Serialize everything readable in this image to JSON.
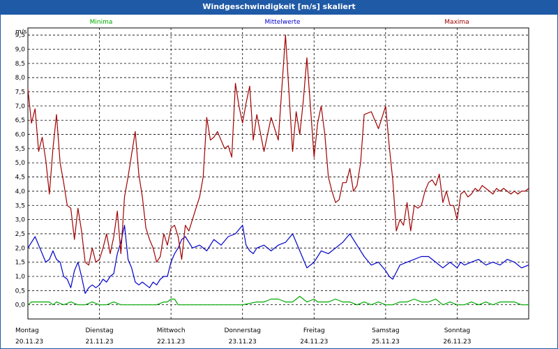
{
  "title": "Windgeschwindigkeit [m/s] skaliert",
  "chart_data": {
    "type": "line",
    "ylabel": "m/s",
    "ylim": [
      -0.5,
      9.75
    ],
    "yticks": [
      0.0,
      0.5,
      1.0,
      1.5,
      2.0,
      2.5,
      3.0,
      3.5,
      4.0,
      4.5,
      5.0,
      5.5,
      6.0,
      6.5,
      7.0,
      7.5,
      8.0,
      8.5,
      9.0,
      9.5
    ],
    "ytick_labels": [
      "0,0",
      "0,5",
      "1,0",
      "1,5",
      "2,0",
      "2,5",
      "3,0",
      "3,5",
      "4,0",
      "4,5",
      "5,0",
      "5,5",
      "6,0",
      "6,5",
      "7,0",
      "7,5",
      "8,0",
      "8,5",
      "9,0",
      "9,5"
    ],
    "xlim": [
      0,
      7
    ],
    "days": [
      {
        "name": "Montag",
        "date": "20.11.23"
      },
      {
        "name": "Dienstag",
        "date": "21.11.23"
      },
      {
        "name": "Mittwoch",
        "date": "22.11.23"
      },
      {
        "name": "Donnerstag",
        "date": "23.11.23"
      },
      {
        "name": "Freitag",
        "date": "24.11.23"
      },
      {
        "name": "Samstag",
        "date": "25.11.23"
      },
      {
        "name": "Sonntag",
        "date": "26.11.23"
      }
    ],
    "series": [
      {
        "name": "Minima",
        "color": "#00aa00",
        "x": [
          0,
          0.05,
          0.1,
          0.2,
          0.3,
          0.35,
          0.4,
          0.5,
          0.6,
          0.7,
          0.8,
          0.9,
          1.0,
          1.1,
          1.2,
          1.3,
          1.4,
          1.5,
          1.6,
          1.7,
          1.8,
          1.9,
          1.95,
          2.0,
          2.05,
          2.1,
          2.2,
          2.4,
          2.6,
          2.8,
          3.0,
          3.2,
          3.3,
          3.4,
          3.5,
          3.6,
          3.7,
          3.8,
          3.9,
          4.0,
          4.05,
          4.1,
          4.2,
          4.3,
          4.4,
          4.5,
          4.6,
          4.7,
          4.8,
          4.9,
          5.0,
          5.1,
          5.2,
          5.3,
          5.4,
          5.5,
          5.6,
          5.7,
          5.8,
          5.9,
          6.0,
          6.1,
          6.2,
          6.3,
          6.4,
          6.5,
          6.6,
          6.7,
          6.8,
          6.9,
          7.0
        ],
        "y": [
          0.0,
          0.1,
          0.1,
          0.1,
          0.1,
          0.0,
          0.1,
          0.0,
          0.1,
          0.0,
          0.0,
          0.1,
          0.0,
          0.0,
          0.1,
          0.0,
          0.0,
          0.0,
          0.0,
          0.0,
          0.0,
          0.1,
          0.1,
          0.2,
          0.2,
          0.0,
          0.0,
          0.0,
          0.0,
          0.0,
          0.0,
          0.1,
          0.1,
          0.2,
          0.2,
          0.1,
          0.1,
          0.3,
          0.1,
          0.2,
          0.1,
          0.1,
          0.1,
          0.2,
          0.1,
          0.1,
          0.0,
          0.1,
          0.0,
          0.1,
          0.0,
          0.0,
          0.1,
          0.1,
          0.2,
          0.1,
          0.1,
          0.2,
          0.0,
          0.1,
          0.0,
          0.0,
          0.1,
          0.0,
          0.1,
          0.0,
          0.1,
          0.1,
          0.1,
          0.0,
          0.0
        ]
      },
      {
        "name": "Mittelwerte",
        "color": "#0000cc",
        "x": [
          0,
          0.05,
          0.1,
          0.15,
          0.2,
          0.25,
          0.3,
          0.35,
          0.4,
          0.45,
          0.5,
          0.55,
          0.6,
          0.65,
          0.7,
          0.75,
          0.8,
          0.85,
          0.9,
          0.95,
          1.0,
          1.05,
          1.1,
          1.15,
          1.2,
          1.25,
          1.3,
          1.35,
          1.4,
          1.45,
          1.5,
          1.55,
          1.6,
          1.65,
          1.7,
          1.75,
          1.8,
          1.85,
          1.9,
          1.95,
          2.0,
          2.05,
          2.1,
          2.15,
          2.2,
          2.25,
          2.3,
          2.4,
          2.5,
          2.6,
          2.7,
          2.8,
          2.9,
          3.0,
          3.05,
          3.1,
          3.15,
          3.2,
          3.3,
          3.4,
          3.5,
          3.6,
          3.7,
          3.8,
          3.9,
          4.0,
          4.05,
          4.1,
          4.2,
          4.3,
          4.4,
          4.5,
          4.6,
          4.7,
          4.8,
          4.9,
          5.0,
          5.05,
          5.1,
          5.2,
          5.3,
          5.4,
          5.5,
          5.6,
          5.7,
          5.8,
          5.9,
          5.95,
          6.0,
          6.05,
          6.1,
          6.2,
          6.3,
          6.4,
          6.5,
          6.6,
          6.7,
          6.8,
          6.9,
          7.0
        ],
        "y": [
          2.0,
          2.2,
          2.4,
          2.1,
          1.8,
          1.5,
          1.6,
          1.9,
          1.6,
          1.5,
          1.0,
          0.9,
          0.6,
          1.2,
          1.5,
          1.0,
          0.4,
          0.6,
          0.7,
          0.6,
          0.7,
          0.9,
          0.8,
          1.0,
          1.1,
          1.8,
          2.2,
          2.8,
          1.6,
          1.3,
          0.8,
          0.7,
          0.8,
          0.7,
          0.6,
          0.8,
          0.7,
          0.9,
          1.0,
          1.0,
          1.5,
          1.8,
          2.0,
          2.3,
          2.4,
          2.2,
          2.0,
          2.1,
          1.9,
          2.3,
          2.1,
          2.4,
          2.5,
          2.8,
          2.1,
          1.9,
          1.8,
          2.0,
          2.1,
          1.9,
          2.1,
          2.2,
          2.5,
          1.9,
          1.3,
          1.5,
          1.7,
          1.9,
          1.8,
          2.0,
          2.2,
          2.5,
          2.1,
          1.7,
          1.4,
          1.5,
          1.2,
          1.0,
          0.9,
          1.4,
          1.5,
          1.6,
          1.7,
          1.7,
          1.5,
          1.3,
          1.5,
          1.4,
          1.3,
          1.5,
          1.4,
          1.5,
          1.6,
          1.4,
          1.5,
          1.4,
          1.6,
          1.5,
          1.3,
          1.4
        ]
      },
      {
        "name": "Maxima",
        "color": "#a00000",
        "x": [
          0,
          0.05,
          0.1,
          0.15,
          0.2,
          0.25,
          0.3,
          0.35,
          0.4,
          0.45,
          0.5,
          0.55,
          0.6,
          0.65,
          0.7,
          0.75,
          0.8,
          0.85,
          0.9,
          0.95,
          1.0,
          1.05,
          1.1,
          1.15,
          1.2,
          1.25,
          1.3,
          1.35,
          1.4,
          1.45,
          1.5,
          1.55,
          1.6,
          1.65,
          1.7,
          1.75,
          1.8,
          1.85,
          1.9,
          1.95,
          2.0,
          2.05,
          2.1,
          2.15,
          2.2,
          2.25,
          2.3,
          2.35,
          2.4,
          2.45,
          2.5,
          2.55,
          2.6,
          2.65,
          2.7,
          2.75,
          2.8,
          2.85,
          2.9,
          2.95,
          3.0,
          3.05,
          3.1,
          3.15,
          3.2,
          3.3,
          3.4,
          3.5,
          3.6,
          3.7,
          3.75,
          3.8,
          3.85,
          3.9,
          4.0,
          4.05,
          4.1,
          4.15,
          4.2,
          4.25,
          4.3,
          4.35,
          4.4,
          4.45,
          4.5,
          4.55,
          4.6,
          4.65,
          4.7,
          4.8,
          4.9,
          5.0,
          5.05,
          5.1,
          5.15,
          5.2,
          5.25,
          5.3,
          5.35,
          5.4,
          5.45,
          5.5,
          5.55,
          5.6,
          5.65,
          5.7,
          5.75,
          5.8,
          5.85,
          5.9,
          5.95,
          6.0,
          6.05,
          6.1,
          6.15,
          6.2,
          6.25,
          6.3,
          6.35,
          6.4,
          6.45,
          6.5,
          6.55,
          6.6,
          6.65,
          6.7,
          6.75,
          6.8,
          6.85,
          6.9,
          6.95,
          7.0
        ],
        "y": [
          7.6,
          6.4,
          6.9,
          5.4,
          5.9,
          5.1,
          3.9,
          5.5,
          6.7,
          5.0,
          4.3,
          3.5,
          3.4,
          2.3,
          3.4,
          2.6,
          1.5,
          1.4,
          2.0,
          1.5,
          1.6,
          2.0,
          2.5,
          1.8,
          2.4,
          3.3,
          1.8,
          3.8,
          4.5,
          5.3,
          6.1,
          4.6,
          3.8,
          2.7,
          2.3,
          2.0,
          1.5,
          1.7,
          2.5,
          2.1,
          2.7,
          2.8,
          2.4,
          1.6,
          2.8,
          2.6,
          3.0,
          3.4,
          3.8,
          4.5,
          6.6,
          5.8,
          5.9,
          6.1,
          5.8,
          5.5,
          5.6,
          5.2,
          7.8,
          7.0,
          6.4,
          7.1,
          7.7,
          5.8,
          6.7,
          5.4,
          6.6,
          5.8,
          9.5,
          5.4,
          6.8,
          6.0,
          7.2,
          8.7,
          5.2,
          6.4,
          7.0,
          6.0,
          4.5,
          4.0,
          3.6,
          3.7,
          4.3,
          4.3,
          4.8,
          4.0,
          4.2,
          5.0,
          6.7,
          6.8,
          6.2,
          7.0,
          5.6,
          4.4,
          2.6,
          3.0,
          2.8,
          3.6,
          2.6,
          3.5,
          3.4,
          3.5,
          4.0,
          4.3,
          4.4,
          4.2,
          4.6,
          3.6,
          4.0,
          3.5,
          3.5,
          3.0,
          3.9,
          4.0,
          3.8,
          3.9,
          4.1,
          4.0,
          4.2,
          4.1,
          4.0,
          3.9,
          4.1,
          4.0,
          4.1,
          4.0,
          3.9,
          4.0,
          3.9,
          4.0,
          4.0,
          4.1
        ]
      }
    ]
  }
}
